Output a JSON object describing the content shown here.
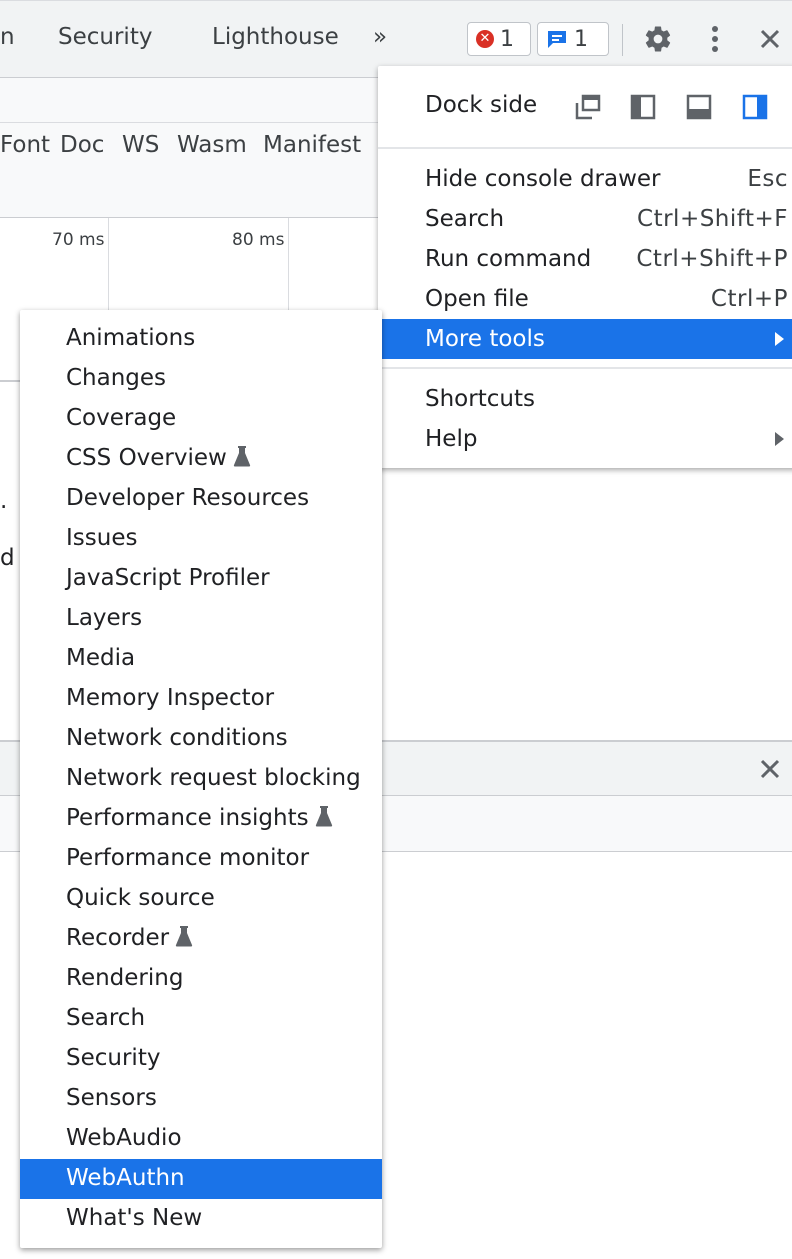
{
  "tabs": [
    "n",
    "Security",
    "Lighthouse"
  ],
  "tab_overflow": "»",
  "badges": {
    "errors": "1",
    "messages": "1"
  },
  "filter_types": [
    "Font",
    "Doc",
    "WS",
    "Wasm",
    "Manifest"
  ],
  "timeline_ticks": [
    "70 ms",
    "80 ms"
  ],
  "side_fragments": [
    ".",
    "d"
  ],
  "main_menu": {
    "dock_label": "Dock side",
    "items": [
      {
        "label": "Hide console drawer",
        "shortcut": "Esc"
      },
      {
        "label": "Search",
        "shortcut": "Ctrl+Shift+F"
      },
      {
        "label": "Run command",
        "shortcut": "Ctrl+Shift+P"
      },
      {
        "label": "Open file",
        "shortcut": "Ctrl+P"
      },
      {
        "label": "More tools",
        "shortcut": ""
      }
    ],
    "bottom_items": [
      {
        "label": "Shortcuts"
      },
      {
        "label": "Help"
      }
    ]
  },
  "more_tools": [
    {
      "label": "Animations"
    },
    {
      "label": "Changes"
    },
    {
      "label": "Coverage"
    },
    {
      "label": "CSS Overview",
      "experimental": true
    },
    {
      "label": "Developer Resources"
    },
    {
      "label": "Issues"
    },
    {
      "label": "JavaScript Profiler"
    },
    {
      "label": "Layers"
    },
    {
      "label": "Media"
    },
    {
      "label": "Memory Inspector"
    },
    {
      "label": "Network conditions"
    },
    {
      "label": "Network request blocking"
    },
    {
      "label": "Performance insights",
      "experimental": true
    },
    {
      "label": "Performance monitor"
    },
    {
      "label": "Quick source"
    },
    {
      "label": "Recorder",
      "experimental": true
    },
    {
      "label": "Rendering"
    },
    {
      "label": "Search"
    },
    {
      "label": "Security"
    },
    {
      "label": "Sensors"
    },
    {
      "label": "WebAudio"
    },
    {
      "label": "WebAuthn",
      "selected": true
    },
    {
      "label": "What's New"
    }
  ],
  "colors": {
    "accent": "#1a73e8",
    "error": "#d93025",
    "icon": "#5f6368"
  }
}
